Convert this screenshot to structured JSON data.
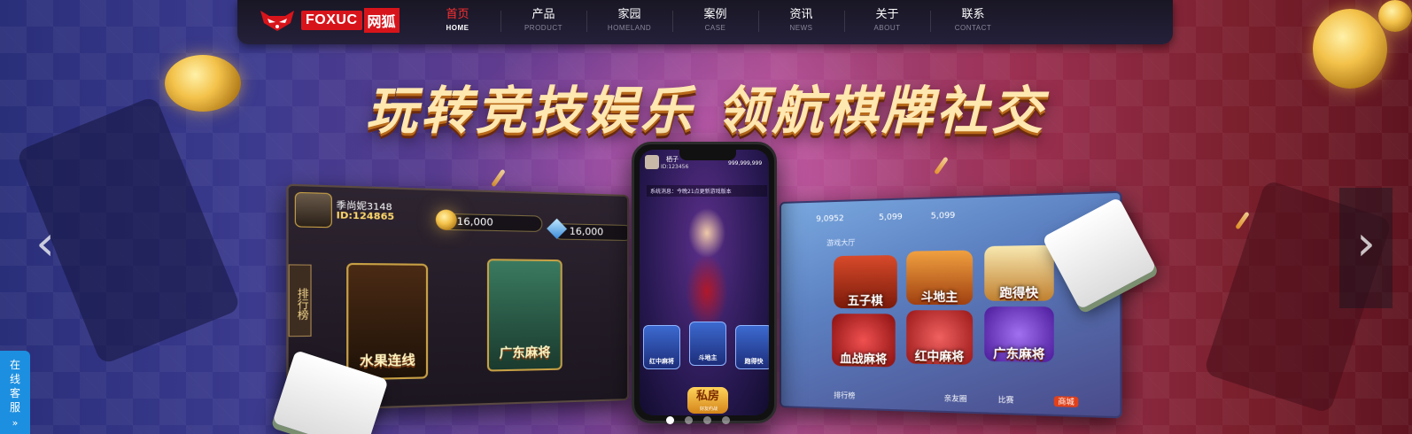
{
  "brand": {
    "logo_en": "FOXUC",
    "logo_cn": "网狐"
  },
  "nav": {
    "items": [
      {
        "cn": "首页",
        "en": "HOME",
        "active": true
      },
      {
        "cn": "产品",
        "en": "PRODUCT",
        "active": false
      },
      {
        "cn": "家园",
        "en": "HOMELAND",
        "active": false
      },
      {
        "cn": "案例",
        "en": "CASE",
        "active": false
      },
      {
        "cn": "资讯",
        "en": "NEWS",
        "active": false
      },
      {
        "cn": "关于",
        "en": "ABOUT",
        "active": false
      },
      {
        "cn": "联系",
        "en": "CONTACT",
        "active": false
      }
    ]
  },
  "banner": {
    "headline": "玩转竞技娱乐  领航棋牌社交",
    "left_screen": {
      "player_name": "季尚妮3148",
      "player_id": "ID:124865",
      "coins": "16,000",
      "gems": "16,000",
      "rank_tab": "排行榜",
      "games": [
        "水果连线",
        "广东麻将"
      ]
    },
    "phone_screen": {
      "player_name": "栖子",
      "player_id": "ID:123456",
      "coins": "999,999,999",
      "notice": "系统消息：今晚21点更新游戏版本",
      "games": [
        "红中麻将",
        "斗地主",
        "跑得快"
      ],
      "private_room": "私房",
      "private_room_sub": "好友约战"
    },
    "right_screen": {
      "coins_a": "9,0952",
      "coins_b": "5,099",
      "coins_c": "5,099",
      "category": "游戏大厅",
      "games": [
        "五子棋",
        "斗地主",
        "跑得快",
        "血战麻将",
        "红中麻将",
        "广东麻将"
      ],
      "bottom_items": [
        "排行榜",
        "亲友圈",
        "比赛",
        "商城"
      ]
    },
    "slides": {
      "count": 4,
      "active_index": 0
    }
  },
  "service": {
    "label_chars": [
      "在",
      "线",
      "客",
      "服"
    ],
    "arrow": "»"
  },
  "colors": {
    "nav_active": "#ff3030",
    "logo_red": "#d8141b",
    "service_blue": "#1d8fe0"
  },
  "icons": {
    "prev": "chevron-left-icon",
    "next": "chevron-right-icon",
    "logo": "fox-icon"
  }
}
